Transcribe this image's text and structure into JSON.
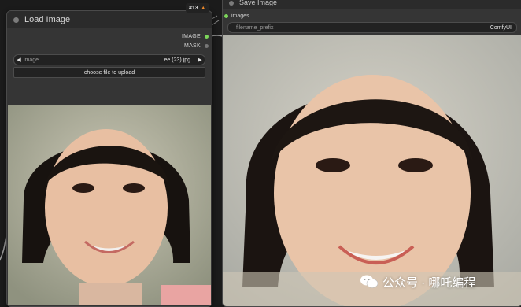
{
  "load_node": {
    "title": "Load Image",
    "outputs": [
      "IMAGE",
      "MASK"
    ],
    "image_widget": {
      "label": "image",
      "value": "ee (23).jpg"
    },
    "upload_button": "choose file to upload"
  },
  "badge": {
    "text": "#13",
    "icon": "fox-icon"
  },
  "save_node": {
    "title": "Save Image",
    "input_label": "images",
    "filename_prefix": {
      "label": "filename_prefix",
      "value": "ComfyUI"
    }
  },
  "watermark": {
    "text": "公众号 · 哪吒编程",
    "icon": "wechat-icon"
  },
  "colors": {
    "canvas": "#1b1b1b",
    "node_bg": "#353535",
    "title_bg": "#2b2b2b",
    "image_slot": "#7cd65a",
    "mask_slot": "#777777",
    "badge_icon": "#f08a2a"
  }
}
